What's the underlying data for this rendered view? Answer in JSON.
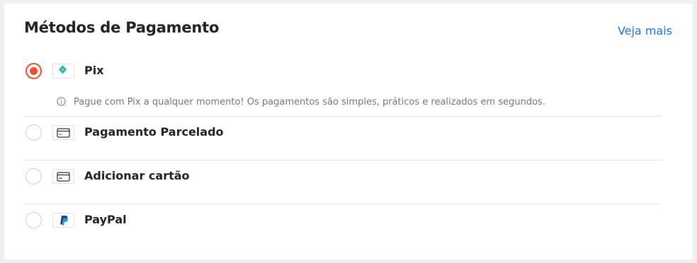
{
  "header": {
    "title": "Métodos de Pagamento",
    "see_more": "Veja mais"
  },
  "methods": [
    {
      "label": "Pix",
      "icon": "pix-logo-icon",
      "selected": true,
      "info": "Pague com Pix a qualquer momento! Os pagamentos são simples, práticos e realizados em segundos."
    },
    {
      "label": "Pagamento Parcelado",
      "icon": "credit-card-icon",
      "selected": false
    },
    {
      "label": "Adicionar cartão",
      "icon": "credit-card-icon",
      "selected": false
    },
    {
      "label": "PayPal",
      "icon": "paypal-logo-icon",
      "selected": false
    }
  ],
  "colors": {
    "accent": "#ee4d2d",
    "link": "#1a73e8",
    "pix": "#32bcad",
    "paypal_dark": "#253b80",
    "paypal_light": "#179bd7"
  }
}
